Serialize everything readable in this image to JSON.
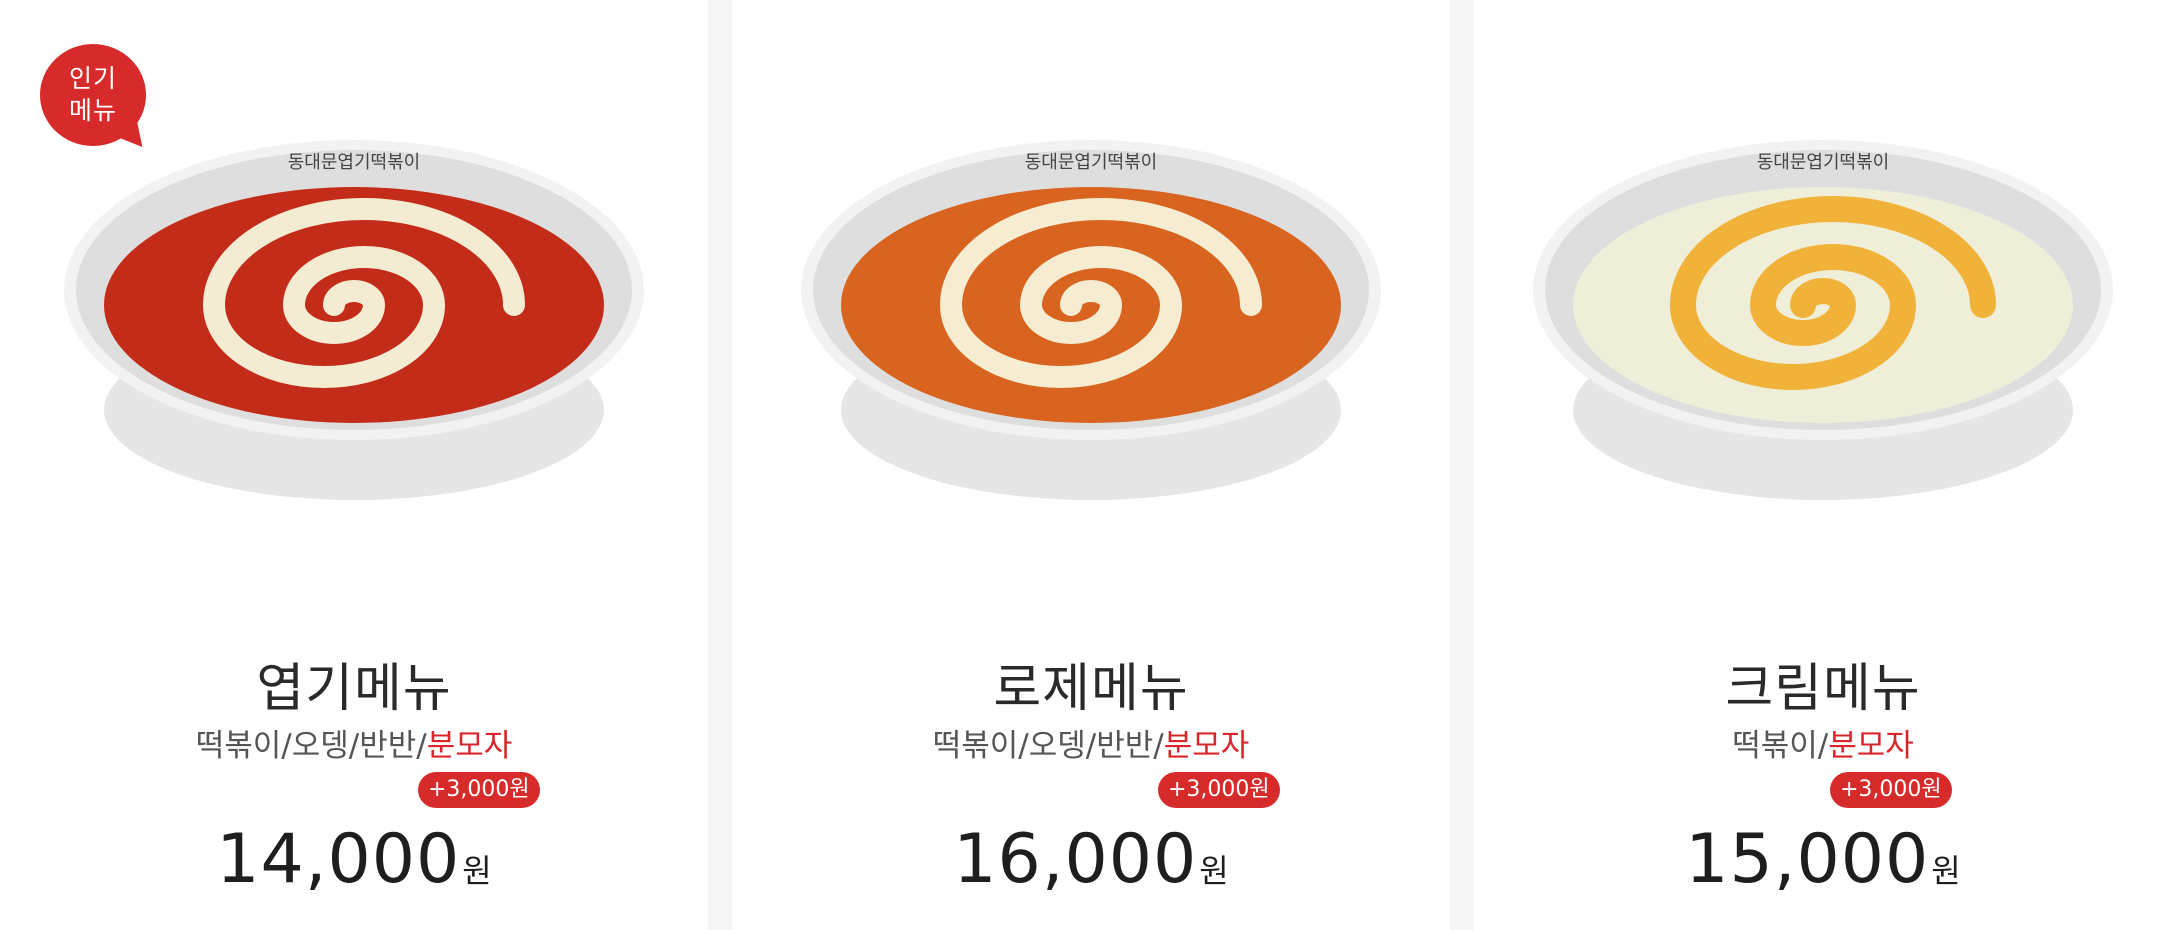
{
  "badge": {
    "line1": "인기",
    "line2": "메뉴",
    "color": "#d72a2a"
  },
  "bowl_brand_text": "동대문엽기떡볶이",
  "menus": [
    {
      "title": "엽기메뉴",
      "options_plain": "떡볶이/오뎅/반반/",
      "options_red": "분모자",
      "extra": "+3,000원",
      "price": "14,000",
      "price_unit": "원",
      "sauce_color": "#c42c1a",
      "swirl_color": "#f3ecd3",
      "popular": true
    },
    {
      "title": "로제메뉴",
      "options_plain": "떡볶이/오뎅/반반/",
      "options_red": "분모자",
      "extra": "+3,000원",
      "price": "16,000",
      "price_unit": "원",
      "sauce_color": "#d8641f",
      "swirl_color": "#f5ecd2",
      "popular": false
    },
    {
      "title": "크림메뉴",
      "options_plain": "떡볶이/",
      "options_red": "분모자",
      "extra": "+3,000원",
      "price": "15,000",
      "price_unit": "원",
      "sauce_color": "#efeed9",
      "swirl_color": "#f1b23a",
      "popular": false
    }
  ],
  "accent_red": "#d8262a"
}
